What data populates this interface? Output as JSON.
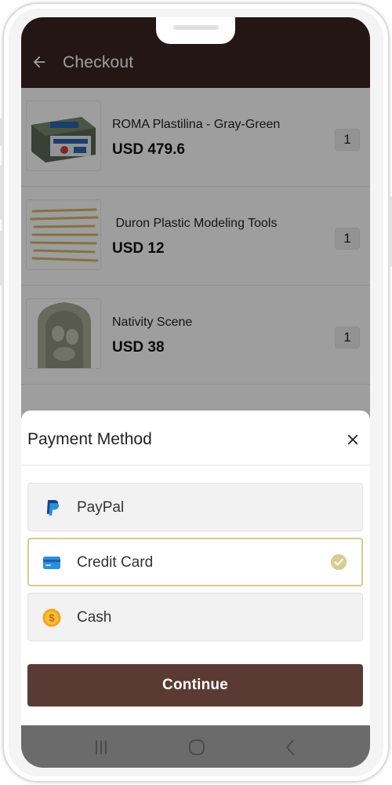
{
  "appbar": {
    "title": "Checkout",
    "back_icon": "arrow-left-icon",
    "color": "#3a2522"
  },
  "cart": {
    "items": [
      {
        "name": "ROMA Plastilina - Gray-Green",
        "price": "USD 479.6",
        "quantity": "1",
        "image": "plastilina-block-image"
      },
      {
        "name": " Duron Plastic Modeling Tools",
        "price": "USD 12",
        "quantity": "1",
        "image": "modeling-tools-image"
      },
      {
        "name": "Nativity Scene",
        "price": "USD 38",
        "quantity": "1",
        "image": "nativity-scene-image"
      }
    ]
  },
  "payment_sheet": {
    "title": "Payment Method",
    "close_icon": "close-icon",
    "options": [
      {
        "label": "PayPal",
        "icon": "paypal-icon",
        "selected": false
      },
      {
        "label": "Credit Card",
        "icon": "credit-card-icon",
        "selected": true
      },
      {
        "label": "Cash",
        "icon": "coin-icon",
        "selected": false
      }
    ],
    "selected_icon": "check-circle-icon",
    "continue_label": "Continue",
    "accent_color": "#5a3b34",
    "selected_border_color": "#d9cc8e"
  },
  "system_nav": {
    "icons": [
      "recent-apps-icon",
      "home-icon",
      "back-icon"
    ]
  }
}
